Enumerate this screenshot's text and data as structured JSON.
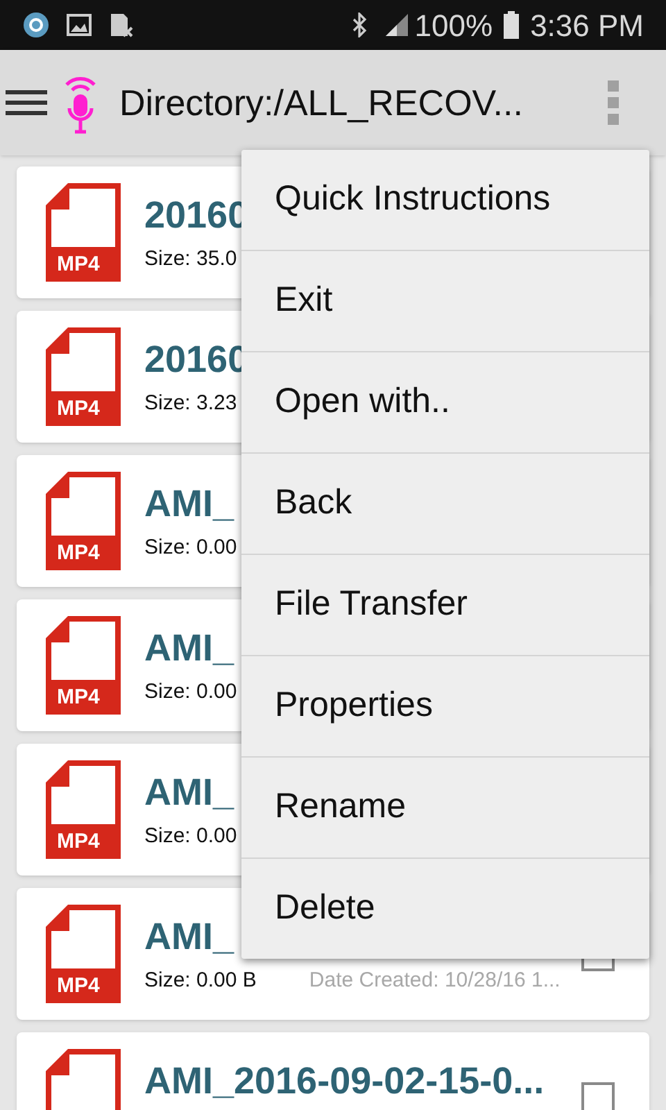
{
  "status_bar": {
    "battery": "100%",
    "time": "3:36 PM"
  },
  "toolbar": {
    "title": "Directory:/ALL_RECOV..."
  },
  "files": [
    {
      "type_label": "MP4",
      "name": "20160",
      "size": "Size: 35.0"
    },
    {
      "type_label": "MP4",
      "name": "20160",
      "size": "Size: 3.23"
    },
    {
      "type_label": "MP4",
      "name": "AMI_",
      "size": "Size: 0.00"
    },
    {
      "type_label": "MP4",
      "name": "AMI_",
      "size": "Size: 0.00"
    },
    {
      "type_label": "MP4",
      "name": "AMI_",
      "size": "Size: 0.00"
    },
    {
      "type_label": "MP4",
      "name": "AMI_",
      "size": "Size: 0.00 B",
      "date": "Date Created: 10/28/16 1...",
      "checked": false
    },
    {
      "name": "AMI_2016-09-02-15-0...",
      "checked": false
    }
  ],
  "menu": [
    "Quick Instructions",
    "Exit",
    "Open with..",
    "Back",
    "File Transfer",
    "Properties",
    "Rename",
    "Delete"
  ]
}
